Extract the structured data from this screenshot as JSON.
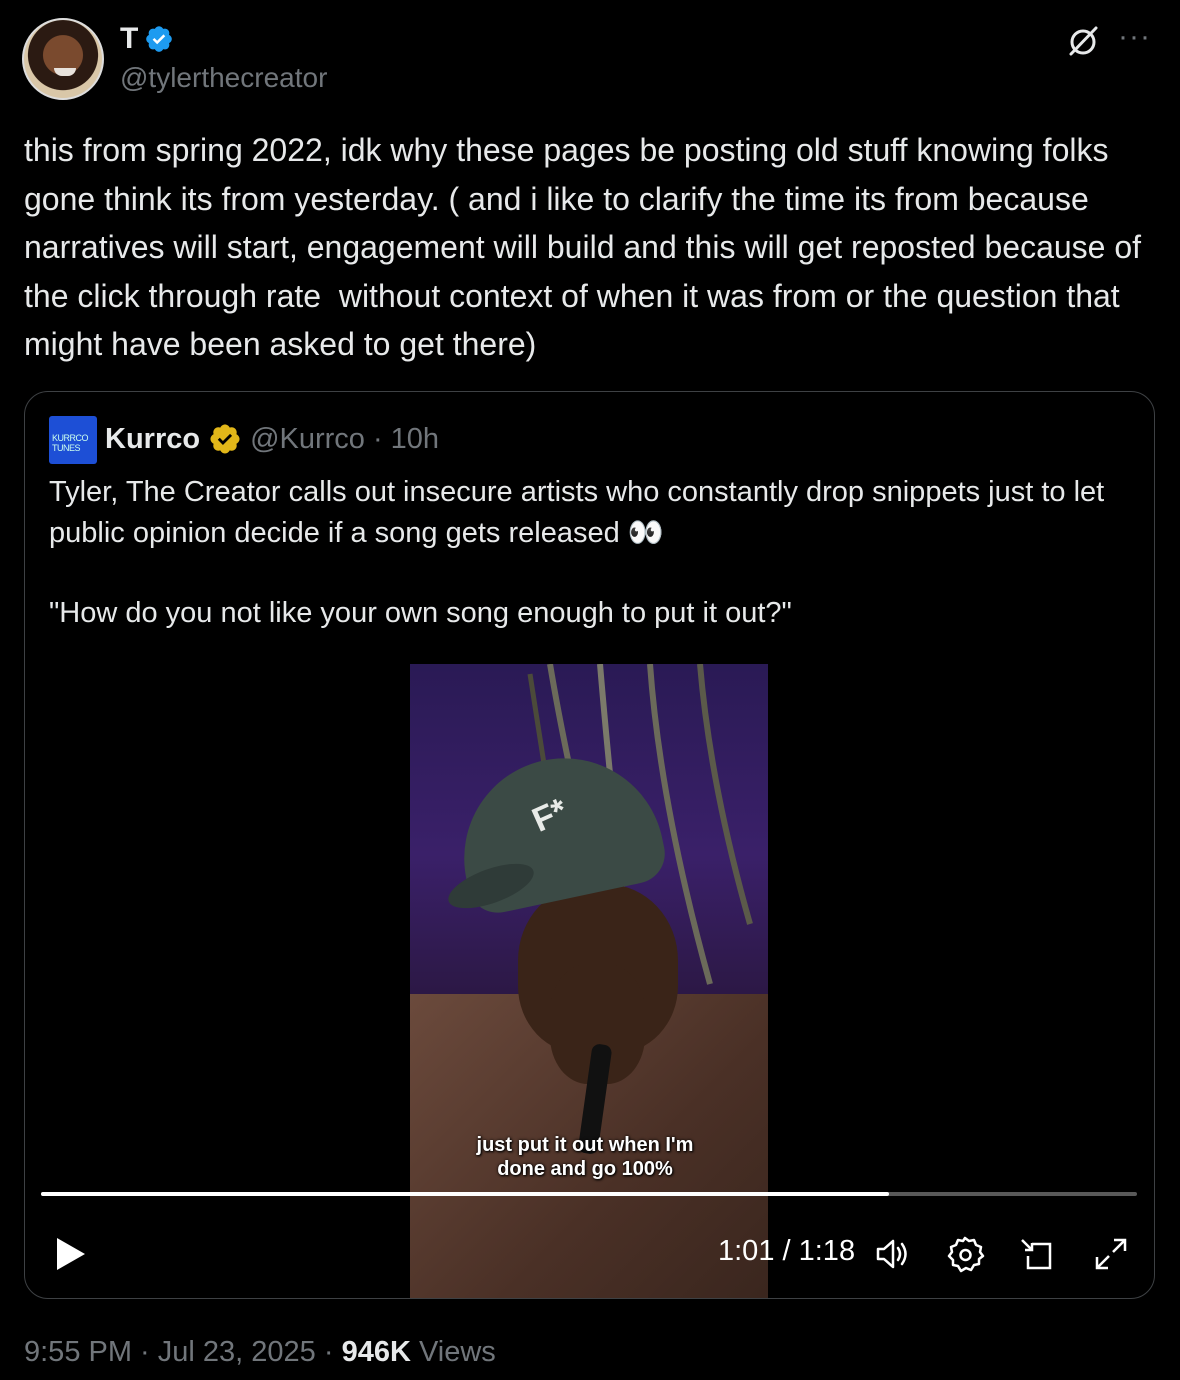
{
  "author": {
    "display_name": "T",
    "handle": "@tylerthecreator",
    "verified_color": "#1d9bf0"
  },
  "icons": {
    "grok": "grok-icon",
    "more": "more-icon",
    "more_glyph": "···"
  },
  "tweet": {
    "text": "this from spring 2022, idk why these pages be posting old stuff knowing folks gone think its from yesterday. ( and i like to clarify the time its from because narratives will start, engagement will build and this will get reposted because of the click through rate  without context of when it was from or the question that might have been asked to get there)"
  },
  "quote": {
    "avatar_text": "KURRCO TUNES",
    "name": "Kurrco",
    "handle": "@Kurrco",
    "separator": "·",
    "age": "10h",
    "badge_color": "#e2b719",
    "text_line1": "Tyler, The Creator calls out insecure artists who constantly drop snippets just to let public opinion decide if a song gets released ",
    "emoji": "👀",
    "text_line2": "\"How do you not like your own song enough to put it out?\"",
    "video": {
      "cap_logo": "F*",
      "caption": "just put it out when I'm\ndone and go 100%",
      "progress": 0.774,
      "time_current": "1:01",
      "time_sep": " / ",
      "time_total": "1:18",
      "controls": [
        "play-icon",
        "volume-icon",
        "settings-icon",
        "pip-icon",
        "fullscreen-icon"
      ]
    }
  },
  "meta": {
    "time": "9:55 PM",
    "sep1": " · ",
    "date": "Jul 23, 2025",
    "sep2": " · ",
    "views_count": "946K",
    "views_label": " Views"
  }
}
